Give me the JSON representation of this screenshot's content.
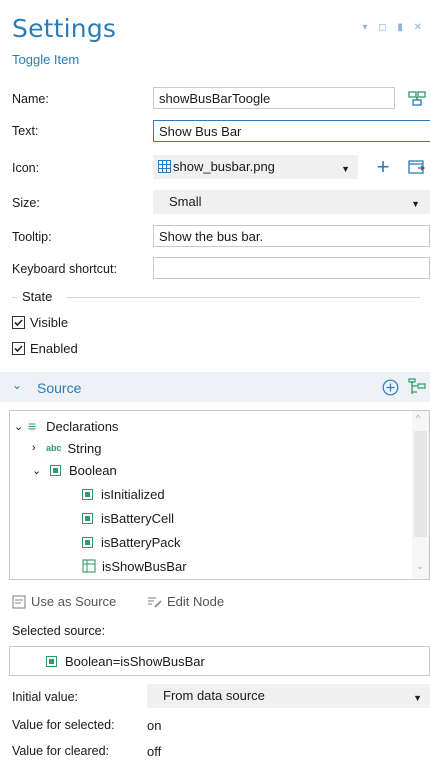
{
  "header": {
    "title": "Settings",
    "subtitle": "Toggle Item",
    "window_controls": "▾ ◻ ▮ ✕"
  },
  "form": {
    "name": {
      "label": "Name:",
      "value": "showBusBarToogle"
    },
    "text": {
      "label": "Text:",
      "value": "Show Bus Bar"
    },
    "icon": {
      "label": "Icon:",
      "value": "show_busbar.png"
    },
    "size": {
      "label": "Size:",
      "value": "Small"
    },
    "tooltip": {
      "label": "Tooltip:",
      "value": "Show the bus bar."
    },
    "shortcut": {
      "label": "Keyboard shortcut:",
      "value": ""
    }
  },
  "state": {
    "legend": "State",
    "visible": {
      "label": "Visible",
      "checked": true
    },
    "enabled": {
      "label": "Enabled",
      "checked": true
    }
  },
  "source": {
    "title": "Source",
    "tree": [
      {
        "label": "Declarations",
        "level": 0,
        "expanded": true,
        "icon": "declarations-icon"
      },
      {
        "label": "String",
        "level": 1,
        "expanded": false,
        "icon": "abc-icon",
        "icon_text": "abc"
      },
      {
        "label": "Boolean",
        "level": 1,
        "expanded": true,
        "icon": "boolean-icon"
      },
      {
        "label": "isInitialized",
        "level": 2,
        "icon": "boolean-icon"
      },
      {
        "label": "isBatteryCell",
        "level": 2,
        "icon": "boolean-icon"
      },
      {
        "label": "isBatteryPack",
        "level": 2,
        "icon": "boolean-icon"
      },
      {
        "label": "isShowBusBar",
        "level": 2,
        "icon": "variable-icon",
        "selected": true
      }
    ],
    "use_as_source": "Use as Source",
    "edit_node": "Edit Node",
    "selected_label": "Selected source:",
    "selected_value": "Boolean=isShowBusBar"
  },
  "initial": {
    "label": "Initial value:",
    "value": "From data source"
  },
  "values": {
    "selected_label": "Value for selected:",
    "selected_value": "on",
    "cleared_label": "Value for cleared:",
    "cleared_value": "off"
  },
  "colors": {
    "accent": "#2a7db8",
    "bool_green": "#2e9a68",
    "selection": "#cce4f7"
  }
}
